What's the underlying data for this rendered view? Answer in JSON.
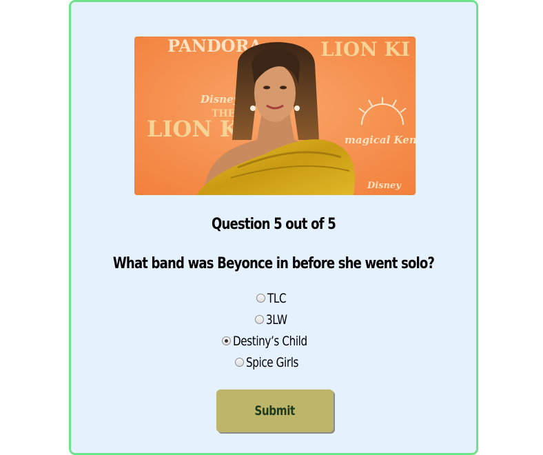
{
  "quiz": {
    "image": {
      "subject": "Beyonce at The Lion King premiere",
      "backdrop_texts": [
        "PANDORA",
        "LION KI",
        "Disney",
        "THE",
        "LION K",
        "magical Kenya",
        "Disney"
      ]
    },
    "counter": "Question 5 out of 5",
    "question": "What band was Beyonce in before she went solo?",
    "options": [
      {
        "label": "TLC",
        "checked": false
      },
      {
        "label": "3LW",
        "checked": false
      },
      {
        "label": "Destiny’s Child",
        "checked": true
      },
      {
        "label": "Spice Girls",
        "checked": false
      }
    ],
    "submit_label": "Submit"
  },
  "colors": {
    "page_bg": "#ffffff",
    "card_bg": "#e5f1fd",
    "card_border": "#6fe38a",
    "submit_bg": "#bcb56a",
    "submit_text": "#1f3b1f"
  }
}
